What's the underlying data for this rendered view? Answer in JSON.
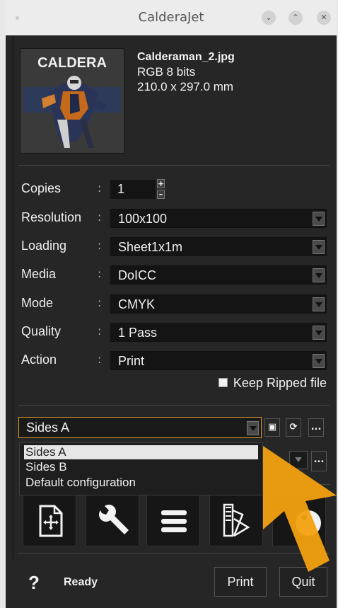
{
  "window": {
    "title": "CalderaJet"
  },
  "file": {
    "thumbnail_text": "CALDERA",
    "name": "Calderaman_2.jpg",
    "color": "RGB 8 bits",
    "size": "210.0 x 297.0 mm"
  },
  "settings": {
    "copies": {
      "label": "Copies",
      "value": "1"
    },
    "resolution": {
      "label": "Resolution",
      "value": "100x100"
    },
    "loading": {
      "label": "Loading",
      "value": "Sheet1x1m"
    },
    "media": {
      "label": "Media",
      "value": "DoICC"
    },
    "mode": {
      "label": "Mode",
      "value": "CMYK"
    },
    "quality": {
      "label": "Quality",
      "value": "1 Pass"
    },
    "action": {
      "label": "Action",
      "value": "Print"
    },
    "colon": ":",
    "keep_ripped": {
      "label": "Keep Ripped file",
      "checked": false
    }
  },
  "config": {
    "selected": "Sides A",
    "options": [
      "Sides A",
      "Sides B",
      "Default configuration"
    ],
    "more_label": "..."
  },
  "toolbar": {
    "icons": [
      "add-page-icon",
      "wrench-icon",
      "list-icon",
      "swatch-icon",
      "palette-icon"
    ]
  },
  "footer": {
    "help": "?",
    "status": "Ready",
    "print_label": "Print",
    "quit_label": "Quit"
  },
  "colors": {
    "accent": "#d89828",
    "pointer": "#f2a10f",
    "background": "#262626"
  }
}
